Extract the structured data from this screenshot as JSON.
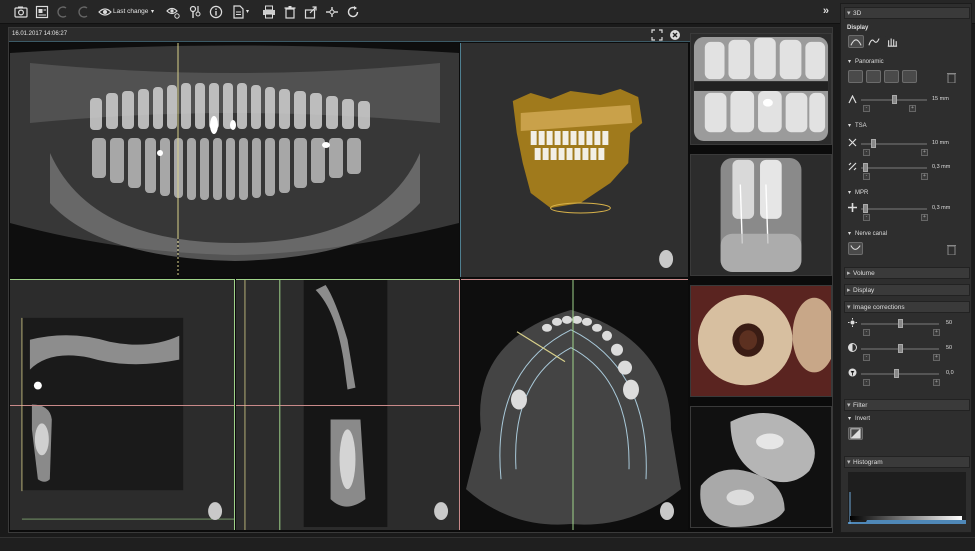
{
  "toolbar": {
    "last_change_label": "Last change",
    "expand_label": "»"
  },
  "viewer": {
    "timestamp": "16.01.2017 14:06:27"
  },
  "panel": {
    "header_3d": "3D",
    "display_label": "Display",
    "panoramic_label": "Panoramic",
    "panoramic_value": "15 mm",
    "tsa_label": "TSA",
    "tsa_value_1": "10 mm",
    "tsa_value_2": "0,3 mm",
    "mpr_label": "MPR",
    "mpr_value": "0,3 mm",
    "nerve_canal_label": "Nerve canal",
    "volume_label": "Volume",
    "display_section_label": "Display",
    "image_corrections_label": "Image corrections",
    "brightness_value": "50",
    "contrast_value": "50",
    "gamma_value": "0,0",
    "filter_label": "Filter",
    "invert_label": "Invert",
    "histogram_label": "Histogram"
  },
  "colors": {
    "toolbar_bg": "#262626",
    "viewer_bg": "#0b0b0b",
    "panel_bg": "#2e2e2e",
    "yellow_line": "#d8d08a",
    "red_line": "#c98a8a",
    "cyan_border": "#4f7f90",
    "green_line": "#9fd38a"
  },
  "icons": [
    "camera-icon",
    "gallery-icon",
    "undo-icon",
    "redo-icon",
    "eye-icon",
    "eye-settings-icon",
    "tools-icon",
    "info-icon",
    "document-icon",
    "print-icon",
    "trash-icon",
    "export-icon",
    "measure-icon",
    "refresh-icon"
  ]
}
